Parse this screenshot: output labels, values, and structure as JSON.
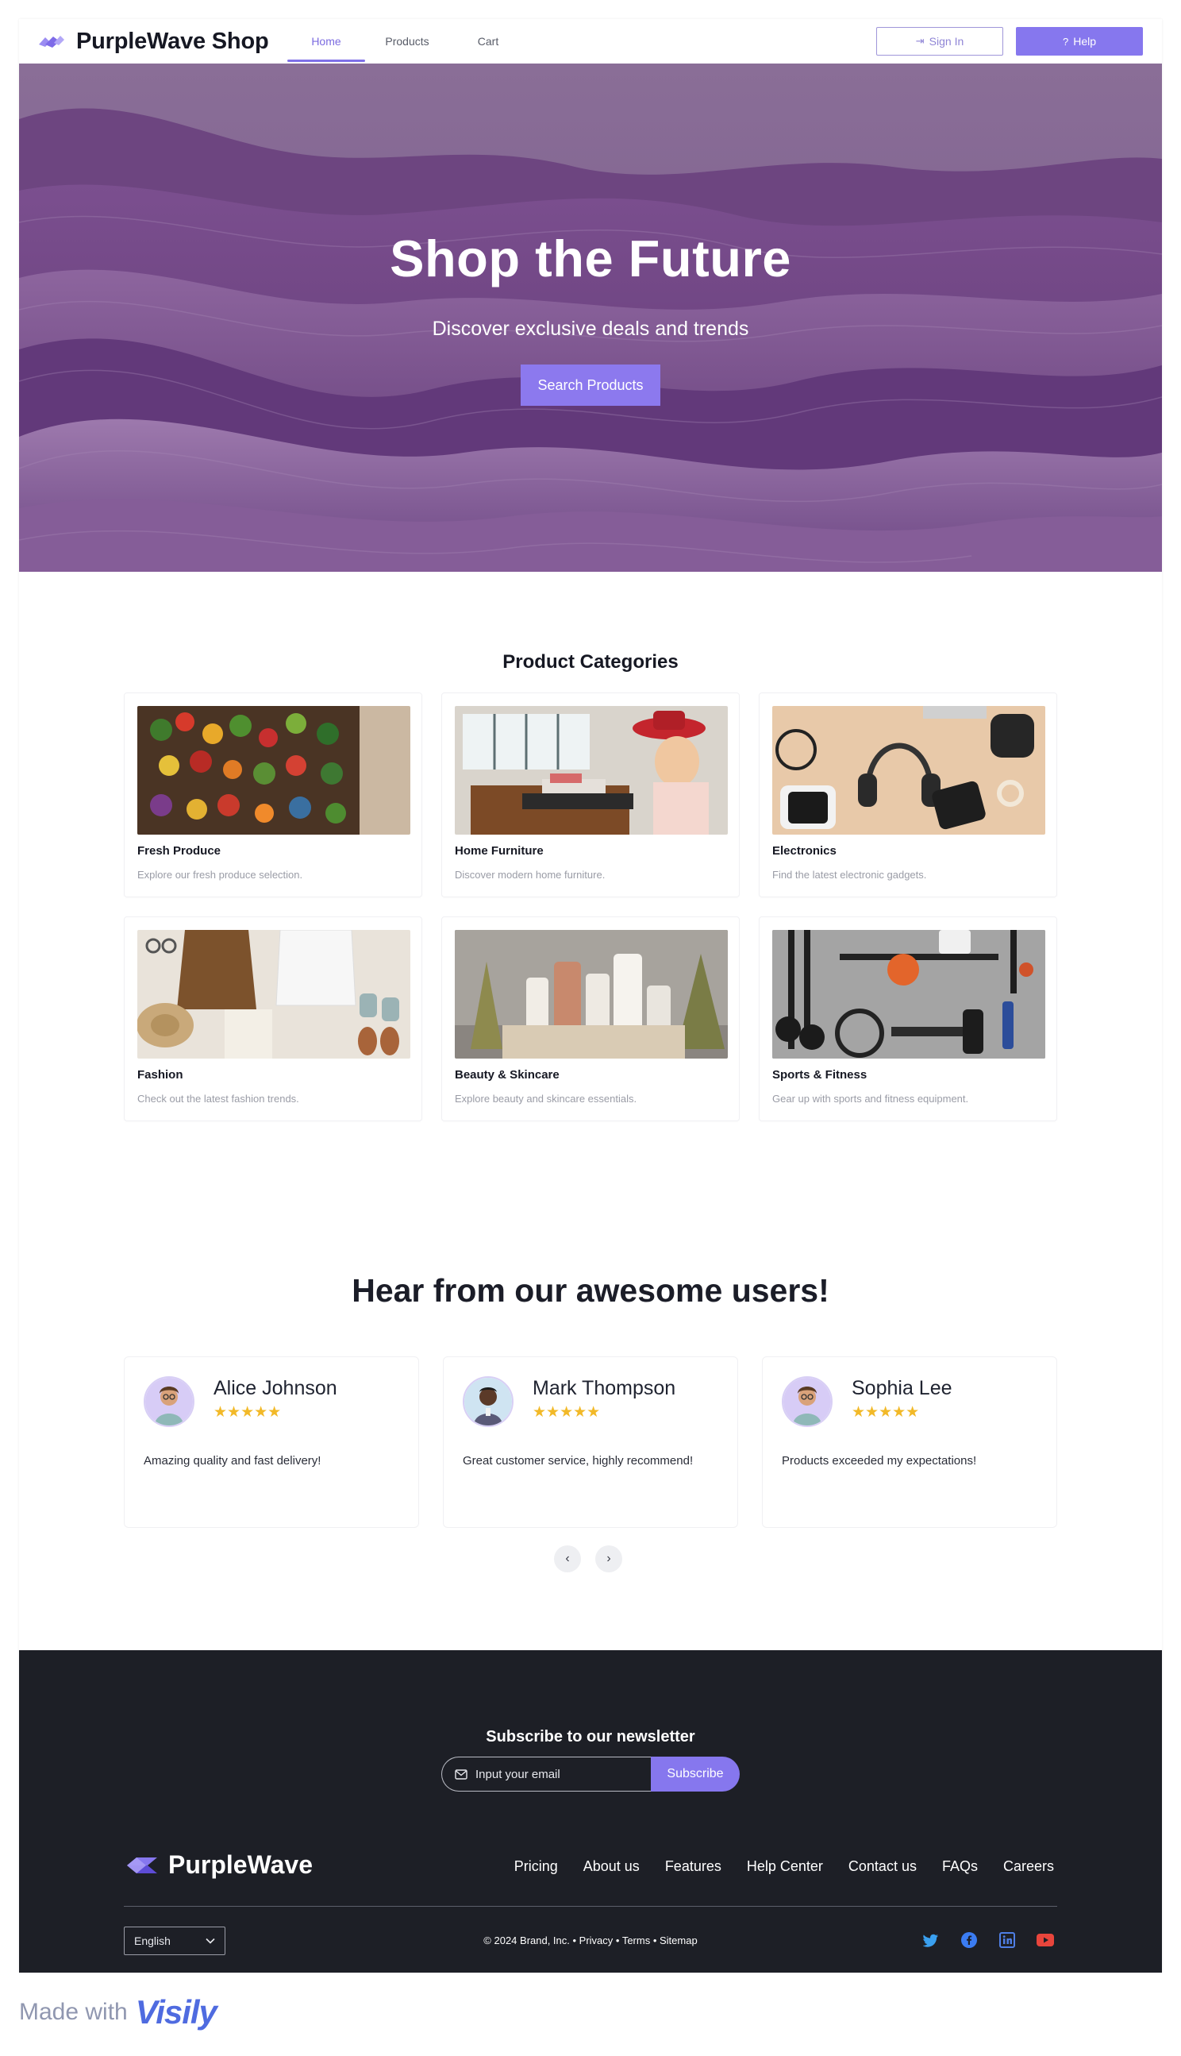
{
  "navbar": {
    "brand": "PurpleWave Shop",
    "tabs": [
      {
        "label": "Home",
        "active": true
      },
      {
        "label": "Products",
        "active": false
      },
      {
        "label": "Cart",
        "active": false
      }
    ],
    "sign_in_label": "Sign In",
    "help_label": "Help"
  },
  "hero": {
    "title": "Shop the Future",
    "subtitle": "Discover exclusive deals and trends",
    "button_label": "Search Products"
  },
  "categories": {
    "title": "Product Categories",
    "items": [
      {
        "name": "Fresh Produce",
        "description": "Explore our fresh produce selection."
      },
      {
        "name": "Home Furniture",
        "description": "Discover modern home furniture."
      },
      {
        "name": "Electronics",
        "description": "Find the latest electronic gadgets."
      },
      {
        "name": "Fashion",
        "description": "Check out the latest fashion trends."
      },
      {
        "name": "Beauty & Skincare",
        "description": "Explore beauty and skincare essentials."
      },
      {
        "name": "Sports & Fitness",
        "description": "Gear up with sports and fitness equipment."
      }
    ]
  },
  "testimonials": {
    "title": "Hear from our awesome users!",
    "items": [
      {
        "name": "Alice Johnson",
        "stars": "★★★★★",
        "rating": 5,
        "text": "Amazing quality and fast delivery!"
      },
      {
        "name": "Mark Thompson",
        "stars": "★★★★★",
        "rating": 5,
        "text": "Great customer service, highly recommend!"
      },
      {
        "name": "Sophia Lee",
        "stars": "★★★★★",
        "rating": 5,
        "text": "Products exceeded my expectations!"
      }
    ],
    "prev_icon": "‹",
    "next_icon": "›"
  },
  "footer": {
    "newsletter_title": "Subscribe to our newsletter",
    "email_placeholder": "Input your email",
    "subscribe_label": "Subscribe",
    "brand": "PurpleWave",
    "links": [
      "Pricing",
      "About us",
      "Features",
      "Help Center",
      "Contact us",
      "FAQs",
      "Careers"
    ],
    "language": "English",
    "copyright": "© 2024 Brand, Inc. • Privacy • Terms • Sitemap",
    "social_icons": [
      "twitter-icon",
      "facebook-icon",
      "linkedin-icon",
      "youtube-icon"
    ]
  },
  "made_with": {
    "text": "Made with",
    "logo": "Visily"
  },
  "colors": {
    "accent": "#8677ee",
    "hero_base": "#6f4a82",
    "footer_bg": "#1d1f26",
    "star": "#f2b928"
  }
}
